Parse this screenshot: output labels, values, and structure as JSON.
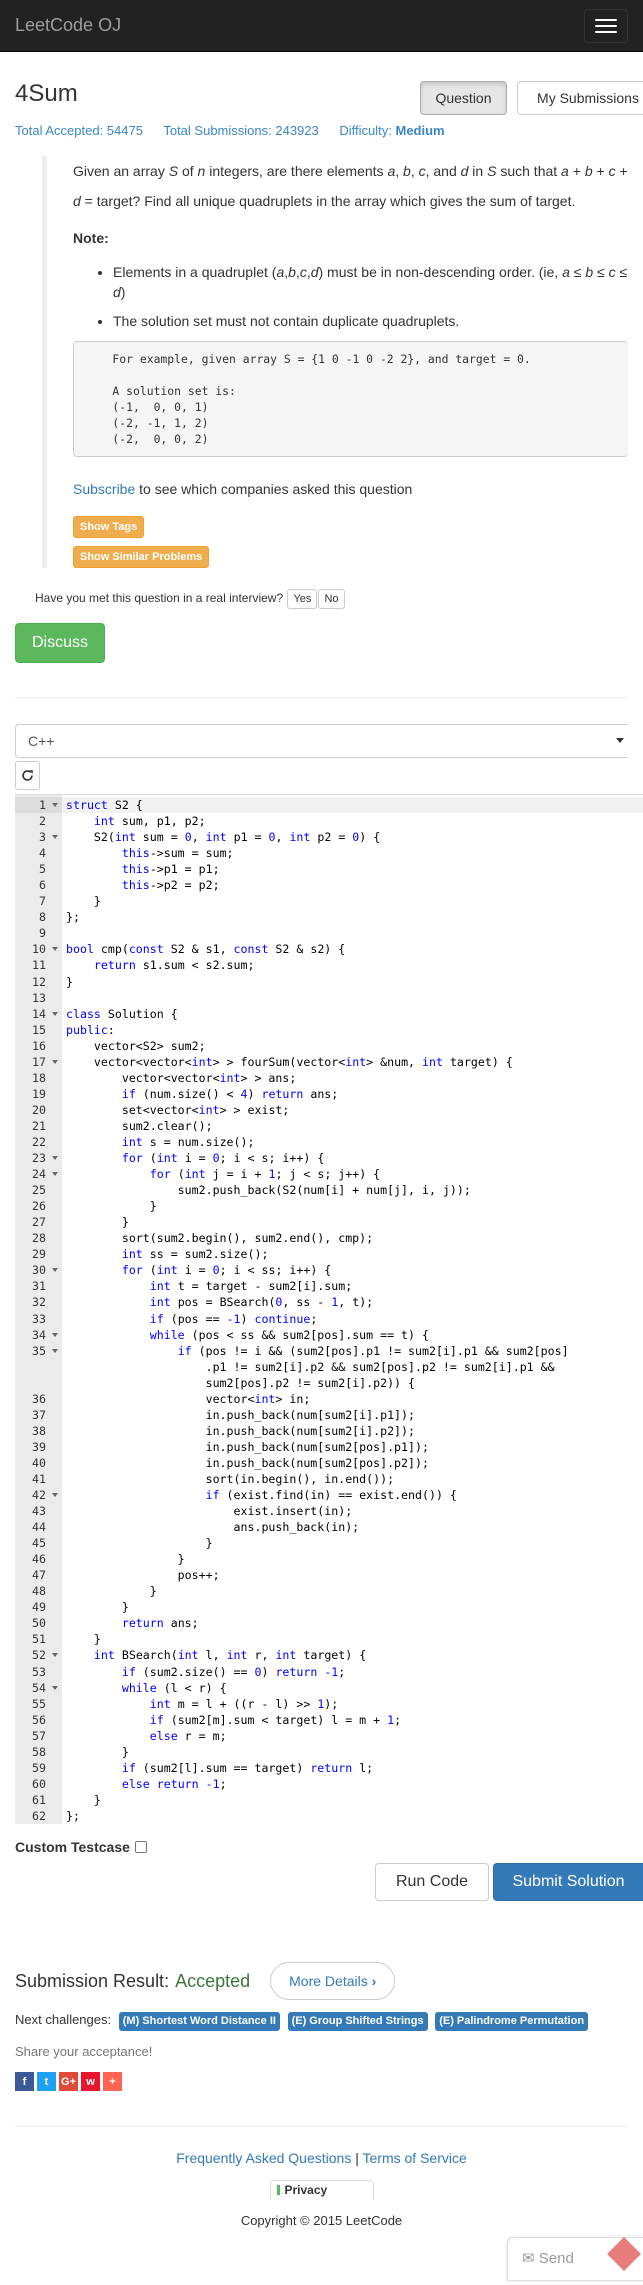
{
  "nav": {
    "brand": "LeetCode OJ"
  },
  "problem": {
    "title": "4Sum",
    "question_button": "Question",
    "submissions_button": "My Submissions",
    "stats": {
      "accepted_label": "Total Accepted:",
      "accepted_value": "54475",
      "submissions_label": "Total Submissions:",
      "submissions_value": "243923",
      "difficulty_label": "Difficulty:",
      "difficulty_value": "Medium"
    },
    "desc_parts": [
      "Given an array ",
      "S",
      " of ",
      "n",
      " integers, are there elements ",
      "a",
      ", ",
      "b",
      ", ",
      "c",
      ", and ",
      "d",
      " in ",
      "S",
      " such that ",
      "a",
      " + ",
      "b",
      " + ",
      "c",
      " + ",
      "d",
      " = target? Find all unique quadruplets in the array which gives the sum of target."
    ],
    "note_label": "Note:",
    "note_items": [
      "Elements in a quadruplet (a,b,c,d) must be in non-descending order. (ie, a ≤ b ≤ c ≤ d)",
      "The solution set must not contain duplicate quadruplets."
    ],
    "example": "    For example, given array S = {1 0 -1 0 -2 2}, and target = 0.\n\n    A solution set is:\n    (-1,  0, 0, 1)\n    (-2, -1, 1, 2)\n    (-2,  0, 0, 2)",
    "subscribe_link": "Subscribe",
    "subscribe_text": " to see which companies asked this question",
    "show_tags": "Show Tags",
    "show_similar": "Show Similar Problems",
    "interview_q": "Have you met this question in a real interview?",
    "yes": "Yes",
    "no": "No",
    "discuss": "Discuss"
  },
  "editor": {
    "language": "C++",
    "active_line": 1,
    "fold_lines": [
      1,
      3,
      10,
      14,
      17,
      23,
      24,
      30,
      34,
      35,
      42,
      52,
      54
    ],
    "lines": [
      "struct S2 {",
      "    int sum, p1, p2;",
      "    S2(int sum = 0, int p1 = 0, int p2 = 0) {",
      "        this->sum = sum;",
      "        this->p1 = p1;",
      "        this->p2 = p2;",
      "    }",
      "};",
      "",
      "bool cmp(const S2 & s1, const S2 & s2) {",
      "    return s1.sum < s2.sum;",
      "}",
      "",
      "class Solution {",
      "public:",
      "    vector<S2> sum2;",
      "    vector<vector<int> > fourSum(vector<int> &num, int target) {",
      "        vector<vector<int> > ans;",
      "        if (num.size() < 4) return ans;",
      "        set<vector<int> > exist;",
      "        sum2.clear();",
      "        int s = num.size();",
      "        for (int i = 0; i < s; i++) {",
      "            for (int j = i + 1; j < s; j++) {",
      "                sum2.push_back(S2(num[i] + num[j], i, j));",
      "            }",
      "        }",
      "        sort(sum2.begin(), sum2.end(), cmp);",
      "        int ss = sum2.size();",
      "        for (int i = 0; i < ss; i++) {",
      "            int t = target - sum2[i].sum;",
      "            int pos = BSearch(0, ss - 1, t);",
      "            if (pos == -1) continue;",
      "            while (pos < ss && sum2[pos].sum == t) {",
      "                if (pos != i && (sum2[pos].p1 != sum2[i].p1 && sum2[pos]\n                    .p1 != sum2[i].p2 && sum2[pos].p2 != sum2[i].p1 &&\n                    sum2[pos].p2 != sum2[i].p2)) {",
      "                    vector<int> in;",
      "                    in.push_back(num[sum2[i].p1]);",
      "                    in.push_back(num[sum2[i].p2]);",
      "                    in.push_back(num[sum2[pos].p1]);",
      "                    in.push_back(num[sum2[pos].p2]);",
      "                    sort(in.begin(), in.end());",
      "                    if (exist.find(in) == exist.end()) {",
      "                        exist.insert(in);",
      "                        ans.push_back(in);",
      "                    }",
      "                }",
      "                pos++;",
      "            }",
      "        }",
      "        return ans;",
      "    }",
      "    int BSearch(int l, int r, int target) {",
      "        if (sum2.size() == 0) return -1;",
      "        while (l < r) {",
      "            int m = l + ((r - l) >> 1);",
      "            if (sum2[m].sum < target) l = m + 1;",
      "            else r = m;",
      "        }",
      "        if (sum2[l].sum == target) return l;",
      "        else return -1;",
      "    }",
      "};"
    ]
  },
  "actions": {
    "custom_testcase": "Custom Testcase",
    "run": "Run Code",
    "submit": "Submit Solution"
  },
  "result": {
    "label": "Submission Result:",
    "status": "Accepted",
    "more": "More Details",
    "next_label": "Next challenges:",
    "next": [
      "(M) Shortest Word Distance II",
      "(E) Group Shifted Strings",
      "(E) Palindrome Permutation"
    ],
    "share": "Share your acceptance!",
    "social": [
      {
        "glyph": "f",
        "color": "#3b5998",
        "icon": "facebook-icon"
      },
      {
        "glyph": "t",
        "color": "#1da1f2",
        "icon": "twitter-icon"
      },
      {
        "glyph": "G+",
        "color": "#dd4b39",
        "icon": "google-plus-icon"
      },
      {
        "glyph": "w",
        "color": "#e6162d",
        "icon": "weibo-icon"
      },
      {
        "glyph": "+",
        "color": "#ff6550",
        "icon": "addthis-icon"
      }
    ]
  },
  "footer": {
    "faq": "Frequently Asked Questions",
    "divider": " | ",
    "tos": "Terms of Service",
    "privacy": "Privacy",
    "copyright": "Copyright © 2015 LeetCode",
    "feedback": "Send Feedback"
  }
}
